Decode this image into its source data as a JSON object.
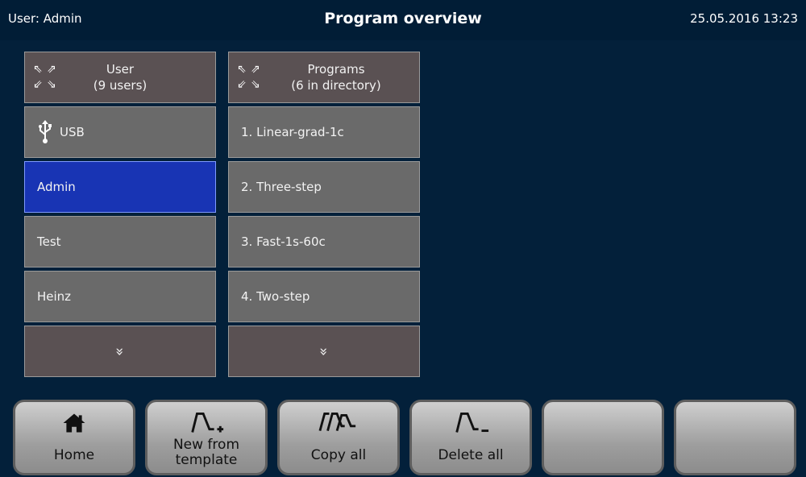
{
  "header": {
    "user": "User: Admin",
    "title": "Program overview",
    "datetime": "25.05.2016 13:23"
  },
  "users_panel": {
    "title": "User",
    "subtitle": "(9 users)",
    "items": [
      "USB",
      "Admin",
      "Test",
      "Heinz"
    ],
    "selected": "Admin"
  },
  "programs_panel": {
    "title": "Programs",
    "subtitle": "(6 in directory)",
    "items": [
      "1. Linear-grad-1c",
      "2. Three-step",
      "3. Fast-1s-60c",
      "4. Two-step"
    ]
  },
  "scroll_glyph": "»",
  "toolbar": {
    "home": "Home",
    "new_from_template_1": "New from",
    "new_from_template_2": "template",
    "copy_all": "Copy all",
    "delete_all": "Delete all"
  },
  "icons": {
    "home": "home-icon",
    "new": "curve-plus-icon",
    "copy": "curve-copy-icon",
    "delete": "curve-minus-icon",
    "usb": "usb-icon",
    "expand": "expand-arrows-icon",
    "scroll": "chevron-double-down-icon"
  },
  "colors": {
    "background": "#03203a",
    "cell": "#6a6a6a",
    "header_cell": "#5a5153",
    "selected": "#1834b4"
  }
}
